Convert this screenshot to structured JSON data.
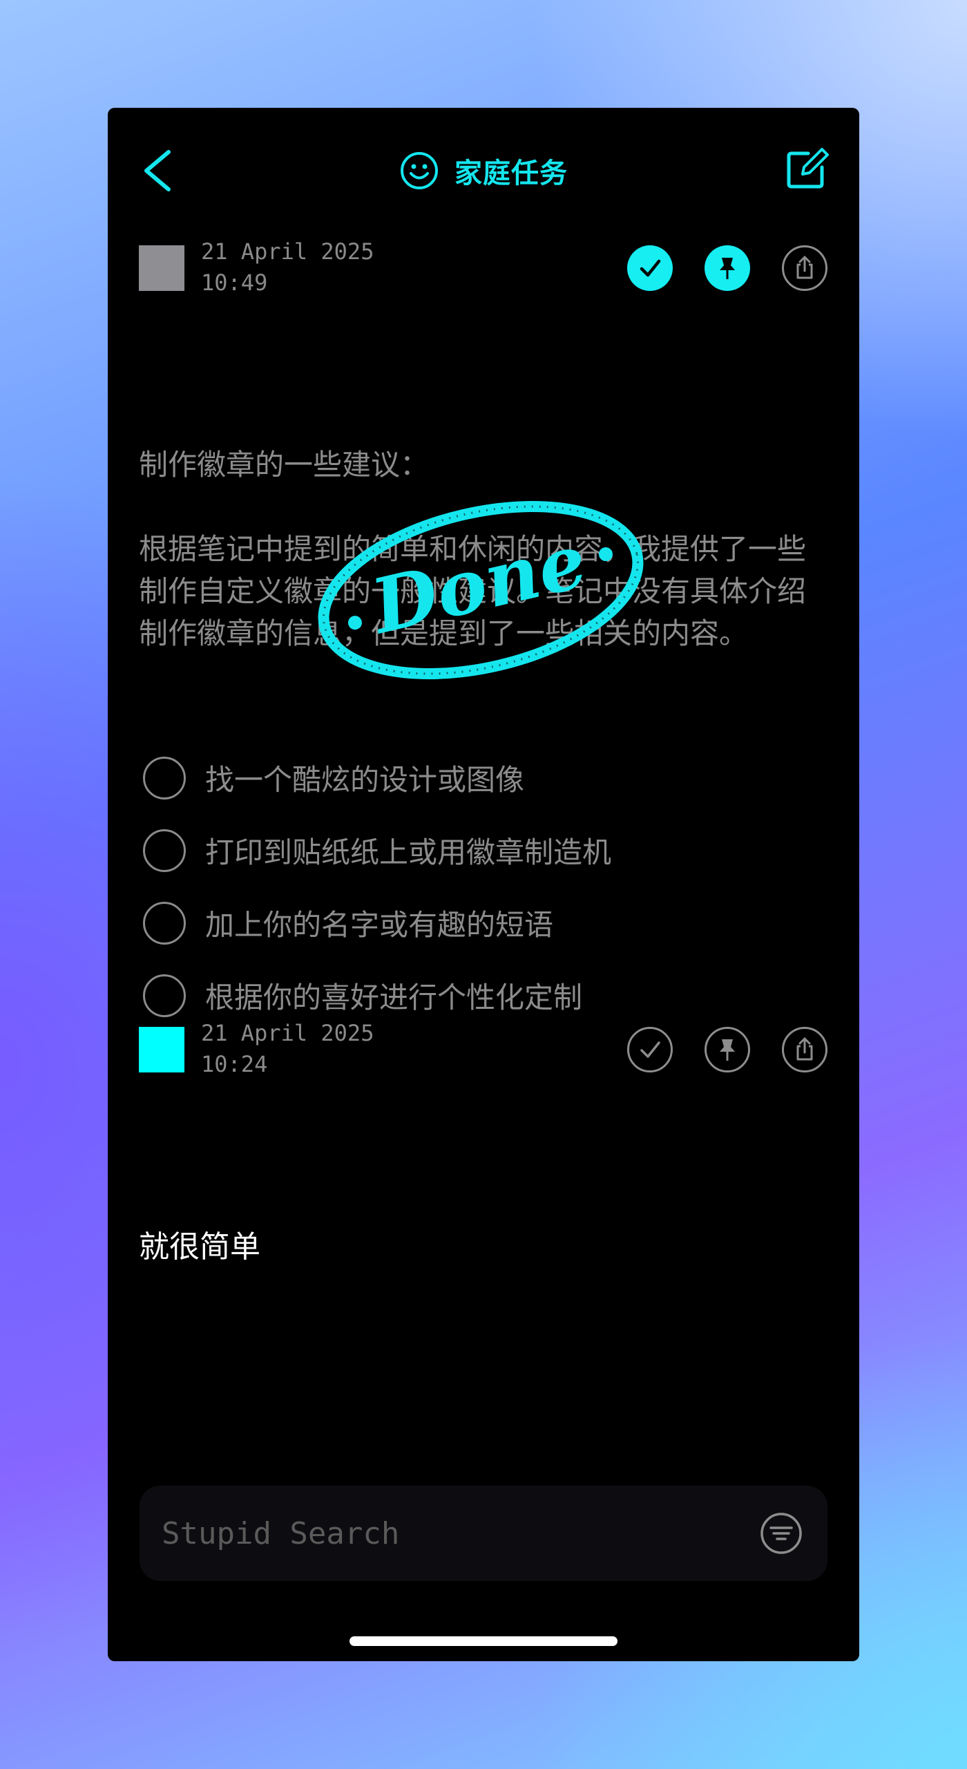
{
  "header": {
    "title": "家庭任务",
    "accent_color": "#15e6ee",
    "back_icon": "chevron-left-icon",
    "title_icon": "smiley-icon",
    "compose_icon": "compose-icon"
  },
  "notes": [
    {
      "date": "21 April 2025",
      "time": "10:49",
      "swatch_color": "#8e8e93",
      "done": true,
      "pinned": true,
      "title_line": "制作徽章的一些建议：",
      "paragraph": "根据笔记中提到的简单和休闲的内容，我提供了一些制作自定义徽章的一般性建议。笔记中没有具体介绍制作徽章的信息，但是提到了一些相关的内容。",
      "checklist": [
        "找一个酷炫的设计或图像",
        "打印到贴纸纸上或用徽章制造机",
        "加上你的名字或有趣的短语",
        "根据你的喜好进行个性化定制"
      ],
      "stamp_text": "Done"
    },
    {
      "date": "21 April 2025",
      "time": "10:24",
      "swatch_color": "#00ffff",
      "done": false,
      "pinned": false,
      "text": "就很简单"
    }
  ],
  "search": {
    "placeholder": "Stupid Search",
    "filter_icon": "filter-icon"
  }
}
